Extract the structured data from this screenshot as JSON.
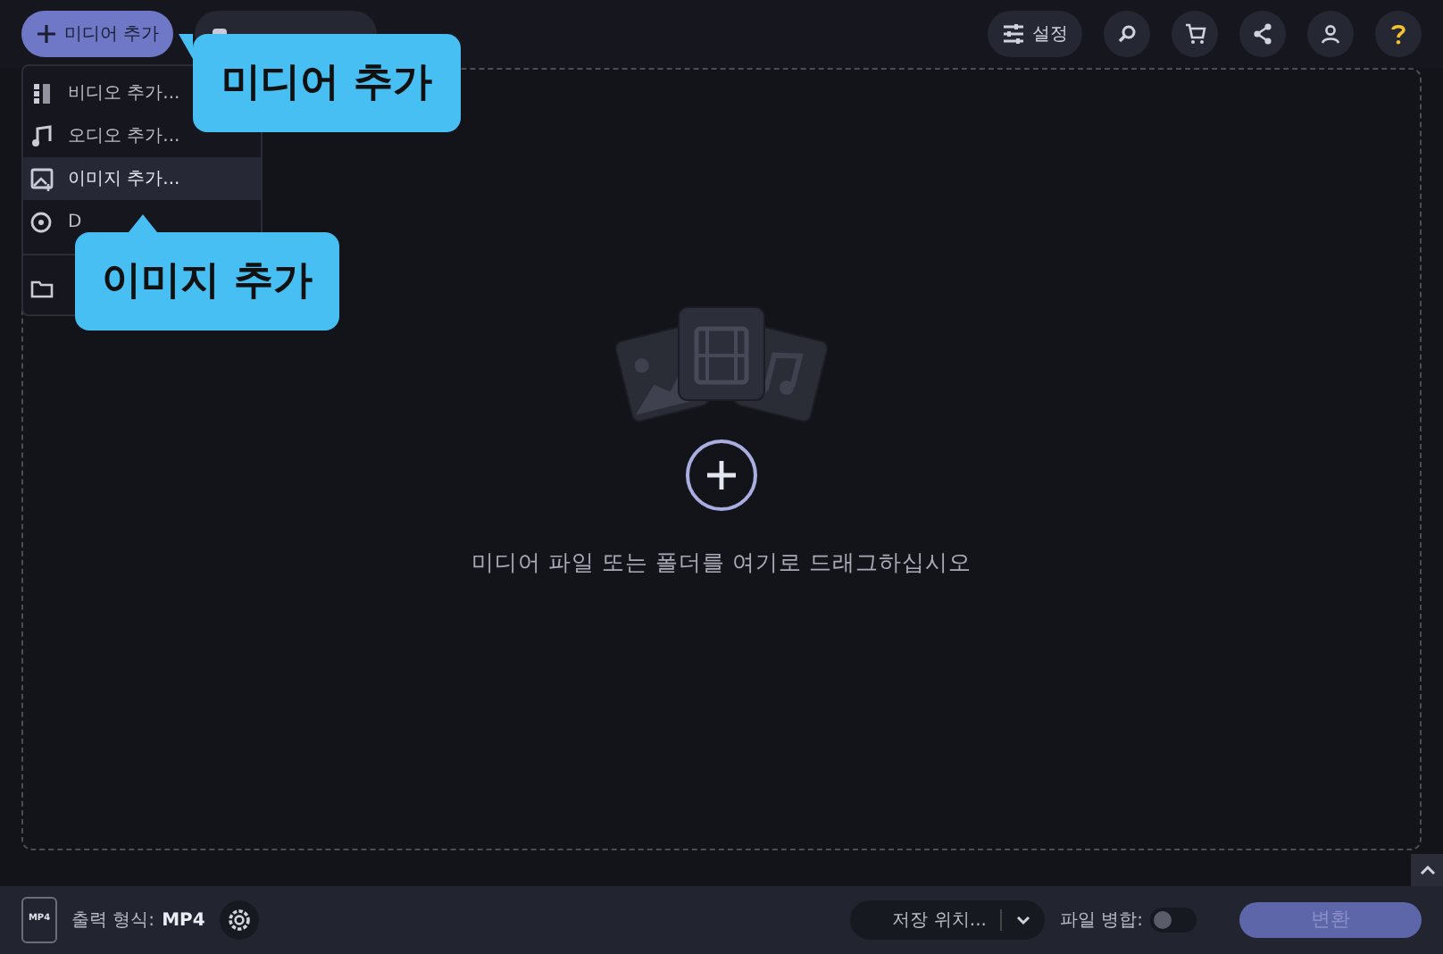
{
  "toolbar": {
    "add_media": "미디어 추가",
    "settings": "설정"
  },
  "add_menu": {
    "items": [
      {
        "kind": "video",
        "label": "비디오 추가...",
        "selected": false
      },
      {
        "kind": "audio",
        "label": "오디오 추가...",
        "selected": false
      },
      {
        "kind": "image",
        "label": "이미지 추가...",
        "selected": true
      },
      {
        "kind": "dvd",
        "label": "D",
        "selected": false
      },
      {
        "kind": "folder",
        "selected": false
      }
    ]
  },
  "callouts": [
    {
      "text": "미디어 추가"
    },
    {
      "text": "이미지 추가"
    }
  ],
  "drop_area": {
    "hint": "미디어 파일 또는 폴더를 여기로 드래그하십시오"
  },
  "bottom_bar": {
    "output_label": "출력 형식:",
    "output_format": "MP4",
    "format_icon_text": "MP4",
    "save_location": "저장 위치...",
    "merge_label": "파일 병합:",
    "merge_on": false,
    "convert": "변환"
  }
}
